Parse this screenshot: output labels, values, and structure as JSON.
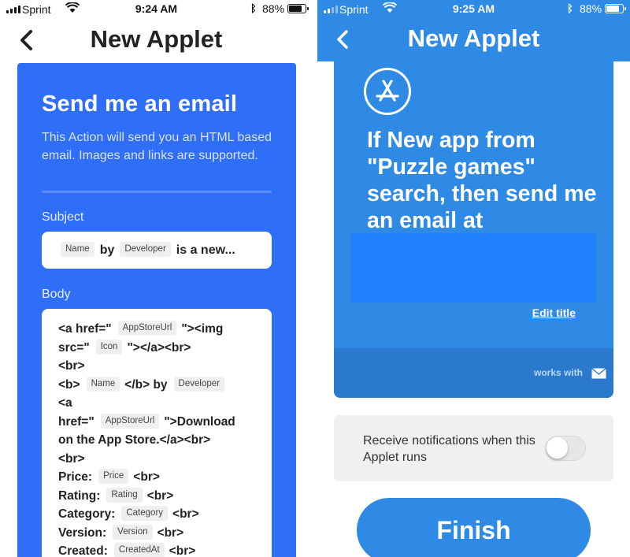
{
  "left": {
    "status": {
      "carrier": "Sprint",
      "time": "9:24 AM",
      "battery": "88%"
    },
    "nav": {
      "title": "New Applet"
    },
    "action": {
      "title": "Send me an email",
      "description": "This Action will send you an HTML based email. Images and links are supported.",
      "subject_label": "Subject",
      "subject": {
        "tag1": "Name",
        "t1": "by",
        "tag2": "Developer",
        "t2": "is a new..."
      },
      "body_label": "Body",
      "body": {
        "l1a": "<a href=\"",
        "l1tag": "AppStoreUrl",
        "l1b": "\"><img",
        "l2a": "src=\"",
        "l2tag": "Icon",
        "l2b": "\"></a><br>",
        "l3": "<br>",
        "l4a": "<b>",
        "l4tag": "Name",
        "l4b": "</b> by",
        "l4tag2": "Developer",
        "l5": "<a",
        "l6a": "href=\"",
        "l6tag": "AppStoreUrl",
        "l6b": "\">Download",
        "l7": "on the App Store.</a><br>",
        "l8": "<br>",
        "l9a": "Price:",
        "l9tag": "Price",
        "l9b": "<br>",
        "l10a": "Rating:",
        "l10tag": "Rating",
        "l10b": "<br>",
        "l11a": "Category:",
        "l11tag": "Category",
        "l11b": "<br>",
        "l12a": "Version:",
        "l12tag": "Version",
        "l12b": "<br>",
        "l13a": "Created:",
        "l13tag": "CreatedAt",
        "l13b": "<br>"
      }
    }
  },
  "right": {
    "status": {
      "carrier": "Sprint",
      "time": "9:25 AM",
      "battery": "88%"
    },
    "nav": {
      "title": "New Applet"
    },
    "applet": {
      "title": "If New app from \"Puzzle games\" search, then send me an email at",
      "edit_title": "Edit title",
      "works_with": "works with"
    },
    "notifications": {
      "label": "Receive notifications when this Applet runs",
      "enabled": false
    },
    "finish_label": "Finish"
  },
  "colors": {
    "left_card": "#2f6ef7",
    "right_accent": "#2f8ae6"
  },
  "icons": [
    "back-chevron-icon",
    "signal-icon",
    "wifi-icon",
    "bluetooth-icon",
    "battery-icon",
    "app-store-icon",
    "mail-icon"
  ]
}
